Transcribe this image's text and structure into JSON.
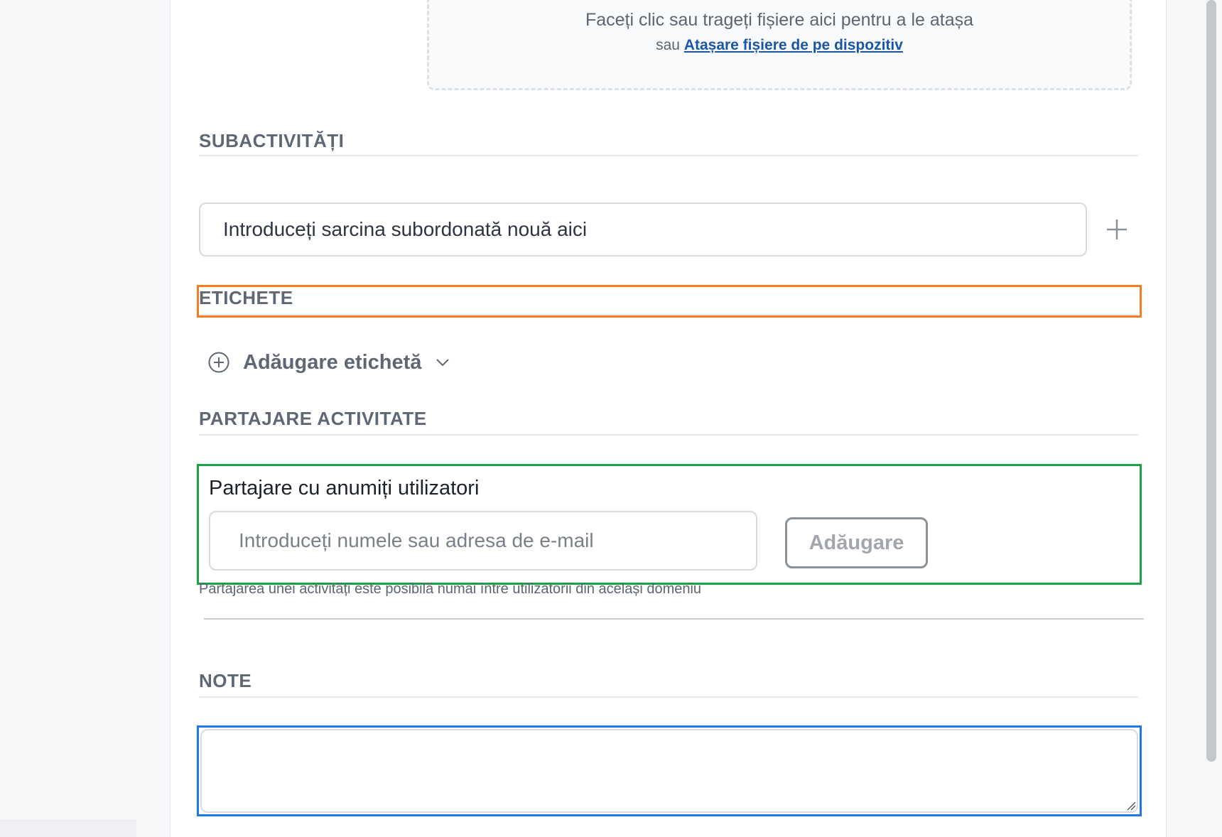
{
  "attachments": {
    "drop_text": "Faceți clic sau trageți fișiere aici pentru a le atașa",
    "or_text": "sau",
    "device_link": "Atașare fișiere de pe dispozitiv"
  },
  "subtasks": {
    "title": "SUBACTIVITĂȚI",
    "input_placeholder": "Introduceți sarcina subordonată nouă aici",
    "add_icon": "plus-icon"
  },
  "labels": {
    "title": "ETICHETE",
    "add_label": "Adăugare etichetă",
    "add_icon": "plus-circle-icon",
    "dropdown_icon": "chevron-down-icon"
  },
  "sharing": {
    "title": "PARTAJARE ACTIVITATE",
    "field_label": "Partajare cu anumiți utilizatori",
    "input_placeholder": "Introduceți numele sau adresa de e-mail",
    "add_button": "Adăugare",
    "hint": "Partajarea unei activități este posibilă numai între utilizatorii din același domeniu"
  },
  "notes": {
    "title": "NOTE",
    "value": ""
  },
  "colors": {
    "link": "#1a56a8",
    "section_title": "#5f6775",
    "highlight_orange": "#f57c20",
    "highlight_green": "#1aa344",
    "highlight_blue": "#1f78e8"
  }
}
